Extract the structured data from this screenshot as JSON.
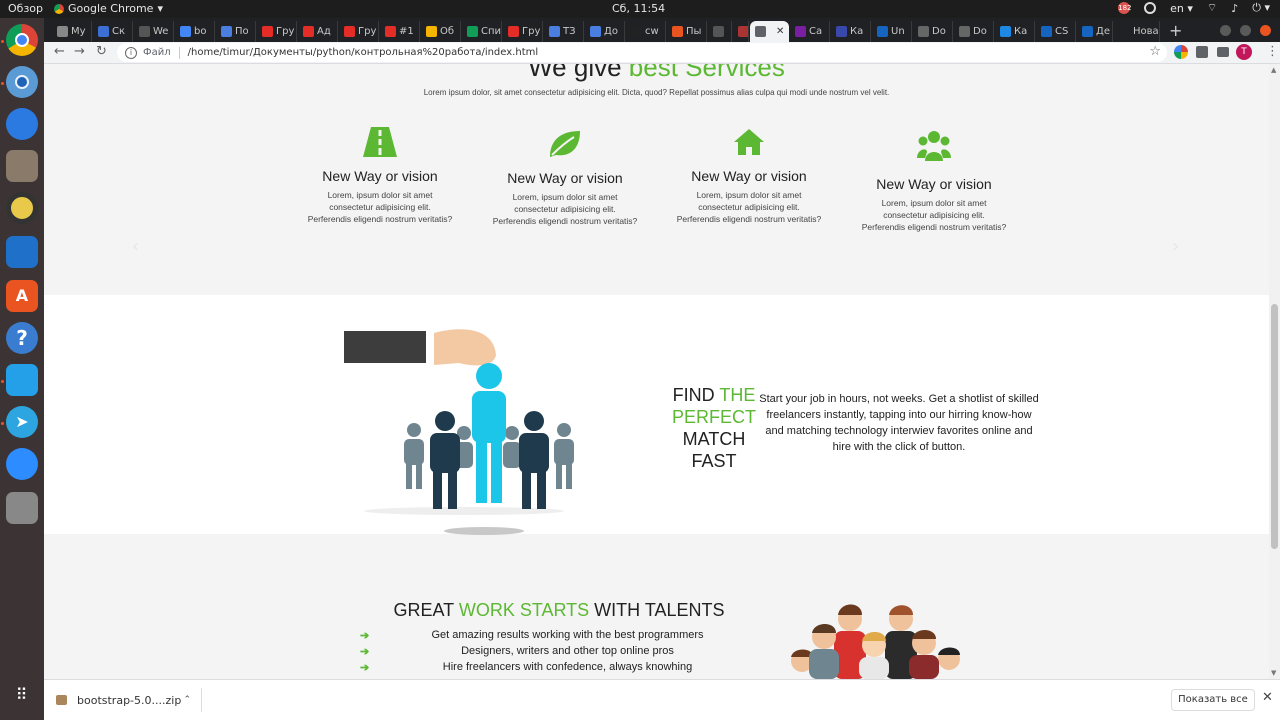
{
  "topbar": {
    "activities": "Обзор",
    "app_name": "Google Chrome",
    "clock": "Сб, 11:54",
    "notif_count": "182",
    "lang": "en"
  },
  "browser": {
    "tabs": [
      {
        "label": "My",
        "color": "#888888"
      },
      {
        "label": "Ск",
        "color": "#3b6fd4"
      },
      {
        "label": "We",
        "color": "#555555"
      },
      {
        "label": "bo",
        "color": "#4285f4"
      },
      {
        "label": "По",
        "color": "#4a7ee0"
      },
      {
        "label": "Гру",
        "color": "#e52d27"
      },
      {
        "label": "Ад",
        "color": "#e52d27"
      },
      {
        "label": "Гру",
        "color": "#e52d27"
      },
      {
        "label": "#1",
        "color": "#e52d27"
      },
      {
        "label": "Об",
        "color": "#f4b400"
      },
      {
        "label": "Спи",
        "color": "#0f9d58"
      },
      {
        "label": "Гру",
        "color": "#e52d27"
      },
      {
        "label": "ТЗ",
        "color": "#4a7ee0"
      },
      {
        "label": "До",
        "color": "#4a7ee0"
      },
      {
        "label": "cw",
        "color": "#222222"
      },
      {
        "label": "Пы",
        "color": "#e95420"
      },
      {
        "label": "",
        "color": "#555555"
      },
      {
        "label": "",
        "color": "#aa3333"
      },
      {
        "label": "",
        "color": "#5f6368",
        "active": true
      },
      {
        "label": "Са",
        "color": "#7b1fa2"
      },
      {
        "label": "Ка",
        "color": "#3949ab"
      },
      {
        "label": "Un",
        "color": "#1565c0"
      },
      {
        "label": "Do",
        "color": "#666666"
      },
      {
        "label": "Do",
        "color": "#666666"
      },
      {
        "label": "Ка",
        "color": "#1e88e5"
      },
      {
        "label": "CS",
        "color": "#1565c0"
      },
      {
        "label": "Де",
        "color": "#1565c0"
      },
      {
        "label": "Новая",
        "color": "#202124"
      }
    ],
    "new_tab_symbol": "+",
    "address": {
      "scheme_label": "Файл",
      "url": "/home/timur/Документы/python/контрольная%20работа/index.html"
    },
    "avatar_letter": "T"
  },
  "page": {
    "services": {
      "title_plain": "We give ",
      "title_accent": "best Services",
      "subtitle": "Lorem ipsum dolor, sit amet consectetur adipisicing elit. Dicta, quod? Repellat possimus alias culpa qui modi unde nostrum vel velit.",
      "items": [
        {
          "icon": "road-icon",
          "title": "New Way or vision",
          "line1": "Lorem, ipsum dolor sit amet",
          "line2": "consectetur adipisicing elit.",
          "line3": "Perferendis eligendi nostrum veritatis?"
        },
        {
          "icon": "leaf-icon",
          "title": "New Way or vision",
          "line1": "Lorem, ipsum dolor sit amet",
          "line2": "consectetur adipisicing elit.",
          "line3": "Perferendis eligendi nostrum veritatis?"
        },
        {
          "icon": "home-icon",
          "title": "New Way or vision",
          "line1": "Lorem, ipsum dolor sit amet",
          "line2": "consectetur adipisicing elit.",
          "line3": "Perferendis eligendi nostrum veritatis?"
        },
        {
          "icon": "users-icon",
          "title": "New Way or vision",
          "line1": "Lorem, ipsum dolor sit amet",
          "line2": "consectetur adipisicing elit.",
          "line3": "Perferendis eligendi nostrum veritatis?"
        }
      ],
      "prev_symbol": "‹",
      "next_symbol": "›"
    },
    "find": {
      "line1_plain": "FIND ",
      "line1_accent": "THE",
      "line2_accent": "PERFECT",
      "line3": "MATCH",
      "line4": "FAST",
      "text": "Start your job in hours, not weeks. Get a shotlist of skilled freelancers instantly, tapping into our hirring know-how and matching technology interwiev favorites online and hire with the click of button."
    },
    "great": {
      "t1": "GREAT ",
      "t2": "WORK STARTS",
      "t3": " WITH TALENTS",
      "items": [
        "Get amazing results working with the best programmers",
        "Designers, writers and other top online pros",
        "Hire freelancers with confedence, always knowhing"
      ]
    },
    "accent_color": "#5cb832"
  },
  "downloads": {
    "file": "bootstrap-5.0....zip",
    "show_all": "Показать все"
  }
}
